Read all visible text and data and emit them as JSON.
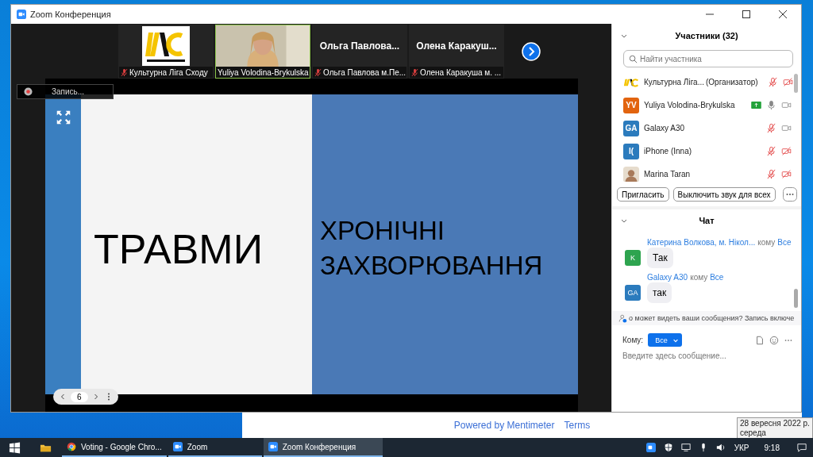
{
  "window": {
    "title": "Zoom Конференция"
  },
  "video_strip": {
    "tiles": [
      {
        "kind": "logo",
        "label": "Культурна Ліга Сходу",
        "muted": true,
        "selected": false
      },
      {
        "kind": "video",
        "label": "Yuliya Volodina-Brykulska",
        "muted": false,
        "selected": true
      },
      {
        "kind": "name",
        "name": "Ольга Павлова...",
        "label": "Ольга Павлова м.Пе...",
        "muted": true,
        "selected": false
      },
      {
        "kind": "name",
        "name": "Олена Каракуш...",
        "label": "Олена Каракуша м. ...",
        "muted": true,
        "selected": false
      }
    ]
  },
  "recording": {
    "label": "Запись..."
  },
  "slide": {
    "left_text": "ТРАВМИ",
    "right_lines": [
      "ХРОНІЧНІ",
      "ЗАХВОРЮВАННЯ"
    ],
    "page": "6"
  },
  "participants": {
    "title": "Участники (32)",
    "search": {
      "placeholder": "Найти участника"
    },
    "items": [
      {
        "kind": "logo",
        "name": "Культурна Ліга...",
        "role": "(Организатор)",
        "muted": true,
        "video": false,
        "raised_hand": false
      },
      {
        "kind": "initials",
        "initials": "YV",
        "color": "#e2640f",
        "name": "Yuliya Volodina-Brykulska",
        "muted": false,
        "video": true,
        "raised_hand": true
      },
      {
        "kind": "initials",
        "initials": "GA",
        "color": "#2b7bbd",
        "name": "Galaxy A30",
        "muted": true,
        "video": true,
        "raised_hand": false
      },
      {
        "kind": "initials",
        "initials": "I(",
        "color": "#2b7bbd",
        "name": "iPhone (Inna)",
        "muted": true,
        "video": false,
        "raised_hand": false
      },
      {
        "name": "Marina Taran",
        "muted": true,
        "video": false,
        "raised_hand": false
      }
    ],
    "buttons": [
      "Пригласить",
      "Выключить звук для всех"
    ]
  },
  "chat": {
    "title": "Чат",
    "messages": [
      {
        "initials": "K",
        "color": "#2ea44f",
        "sender": "Катерина Волкова, м. Нікол...",
        "to": "кому",
        "recipient": "Все",
        "text": "Так"
      },
      {
        "initials": "GA",
        "color": "#2b7bbd",
        "sender": "Galaxy A30",
        "to": "кому",
        "recipient": "Все",
        "text": "так"
      }
    ],
    "notice": "о может видеть ваши сообщения? Запись включе",
    "to_label": "Кому:",
    "recipient": "Все",
    "placeholder": "Введите здесь сообщение..."
  },
  "browser": {
    "links": [
      "Powered by Mentimeter",
      "Terms"
    ]
  },
  "tooltip": {
    "lines": [
      "28 вересня 2022 р.",
      "середа"
    ]
  },
  "taskbar": {
    "apps": [
      {
        "kind": "chrome",
        "label": "Voting - Google Chro...",
        "selected": false
      },
      {
        "kind": "zoom",
        "label": "Zoom",
        "selected": false
      },
      {
        "kind": "zoom",
        "label": "Zoom Конференция",
        "selected": true
      }
    ],
    "language": "УКР",
    "time": "9:18"
  }
}
